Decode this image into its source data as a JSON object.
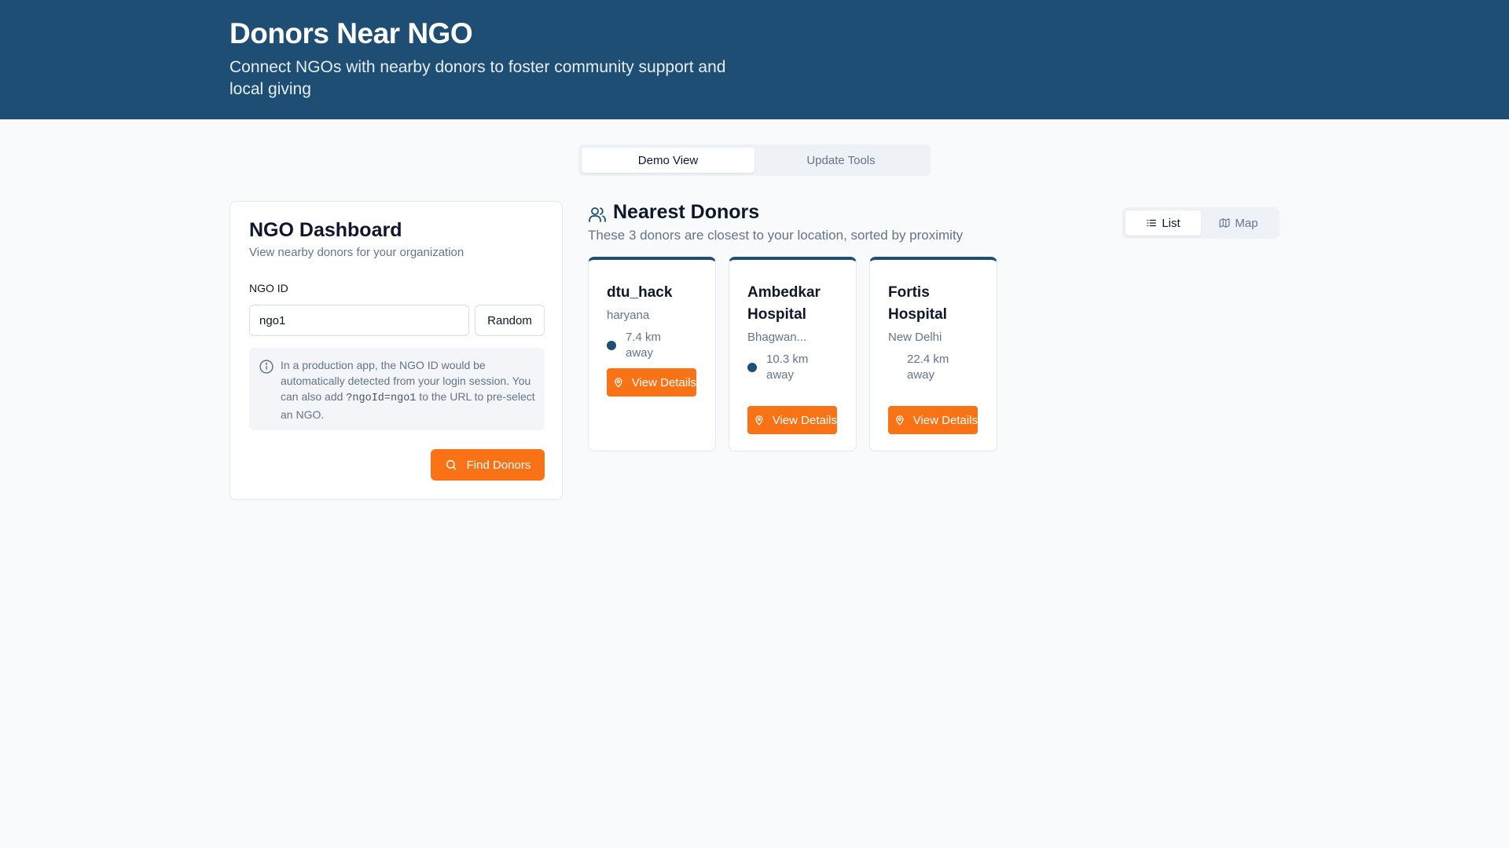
{
  "header": {
    "title": "Donors Near NGO",
    "subtitle": "Connect NGOs with nearby donors to foster community support and local giving"
  },
  "top_tabs": [
    {
      "label": "Demo View",
      "active": true
    },
    {
      "label": "Update Tools",
      "active": false
    }
  ],
  "dashboard": {
    "title": "NGO Dashboard",
    "subtitle": "View nearby donors for your organization",
    "ngo_id_label": "NGO ID",
    "ngo_id_value": "ngo1",
    "random_label": "Random",
    "info_text_1": "In a production app, the NGO ID would be automatically detected from your login session. You can also add ",
    "info_code": "?ngoId=ngo1",
    "info_text_2": " to the URL to pre-select an NGO.",
    "find_label": "Find Donors"
  },
  "nearest": {
    "title": "Nearest Donors",
    "subtitle": "These 3 donors are closest to your location, sorted by proximity",
    "view_toggle": [
      {
        "label": "List",
        "icon": "list-icon",
        "active": true
      },
      {
        "label": "Map",
        "icon": "map-icon",
        "active": false
      }
    ],
    "donors": [
      {
        "name": "dtu_hack",
        "location": "haryana",
        "distance": "7.4 km away",
        "button": "View Details"
      },
      {
        "name": "Ambedkar Hospital",
        "location": "Bhagwan...",
        "distance": "10.3 km away",
        "button": "View Details"
      },
      {
        "name": "Fortis Hospital",
        "location": "New Delhi",
        "distance": "22.4 km away",
        "button": "View Details"
      }
    ]
  },
  "colors": {
    "header_bg": "#1e4e73",
    "accent_orange": "#f97316",
    "page_bg": "#f8fafc"
  }
}
